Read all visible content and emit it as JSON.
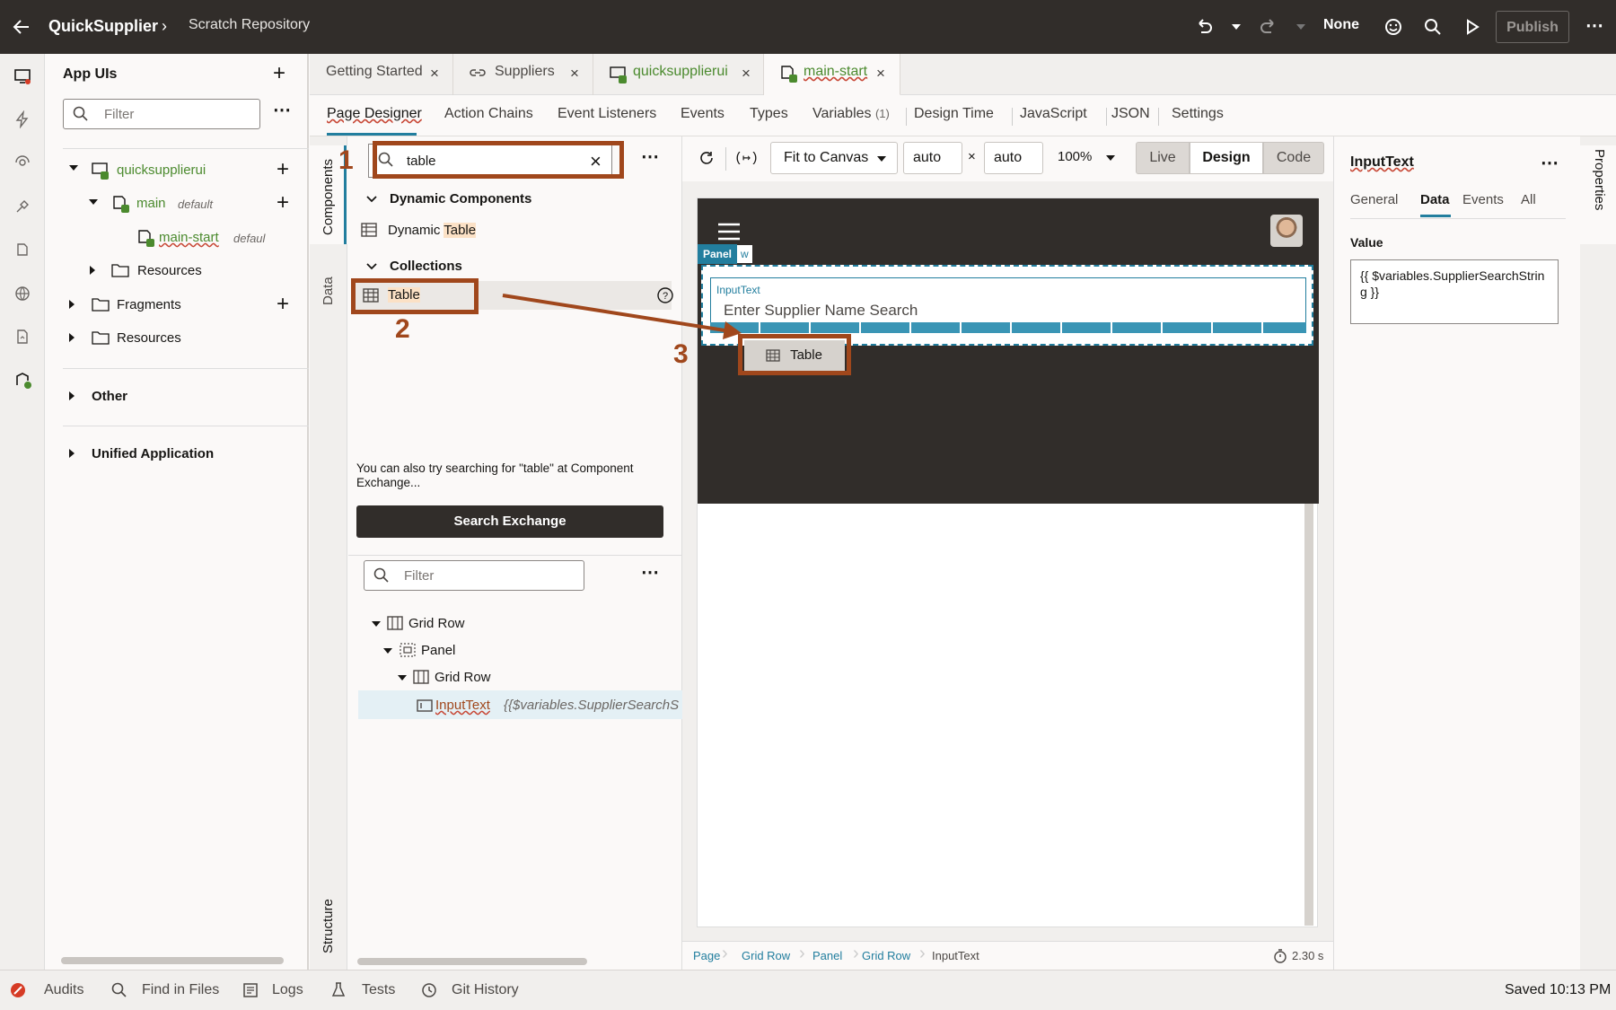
{
  "header": {
    "app_name": "QuickSupplier",
    "breadcrumb": "Scratch Repository",
    "profile": "None",
    "publish_label": "Publish"
  },
  "nav": {
    "title": "App UIs",
    "filter_placeholder": "Filter",
    "tree": {
      "app": "quicksupplierui",
      "main": "main",
      "main_meta": "default",
      "main_start": "main-start",
      "main_start_meta": "defaul",
      "resources_inner": "Resources",
      "fragments": "Fragments",
      "resources": "Resources"
    },
    "other": "Other",
    "unified": "Unified Application"
  },
  "tabs": [
    {
      "label": "Getting Started"
    },
    {
      "label": "Suppliers"
    },
    {
      "label": "quicksupplierui"
    },
    {
      "label": "main-start"
    }
  ],
  "subtabs": {
    "page_designer": "Page Designer",
    "action_chains": "Action Chains",
    "event_listeners": "Event Listeners",
    "events": "Events",
    "types": "Types",
    "variables": "Variables",
    "variables_count": "(1)",
    "design_time": "Design Time",
    "javascript": "JavaScript",
    "json": "JSON",
    "settings": "Settings"
  },
  "vertical_tabs": {
    "components": "Components",
    "data": "Data",
    "structure": "Structure",
    "properties": "Properties"
  },
  "components": {
    "search_value": "table",
    "group_dynamic": "Dynamic Components",
    "dynamic_table_prefix": "Dynamic ",
    "dynamic_table_match": "Table",
    "group_collections": "Collections",
    "table_item": "Table",
    "exchange_hint": "You can also try searching for \"table\" at Component Exchange...",
    "search_exchange": "Search Exchange"
  },
  "structure": {
    "filter_placeholder": "Filter",
    "nodes": {
      "grid_row_1": "Grid Row",
      "panel": "Panel",
      "grid_row_2": "Grid Row",
      "input_text": "InputText",
      "input_text_value": "{{$variables.SupplierSearchS"
    }
  },
  "canvas_toolbar": {
    "fit": "Fit to Canvas",
    "width": "auto",
    "times": "×",
    "height": "auto",
    "zoom": "100%",
    "live": "Live",
    "design": "Design",
    "code": "Code"
  },
  "canvas": {
    "panel_badge": "Panel",
    "panel_badge_tail": "w",
    "input_label": "InputText",
    "input_placeholder": "Enter Supplier Name Search",
    "drag_label": "Table"
  },
  "annotations": {
    "one": "1",
    "two": "2",
    "three": "3"
  },
  "breadcrumb_bar": {
    "items": [
      "Page",
      "Grid Row",
      "Panel",
      "Grid Row",
      "InputText"
    ],
    "timing": "2.30 s"
  },
  "properties": {
    "title": "InputText",
    "tabs": [
      "General",
      "Data",
      "Events",
      "All"
    ],
    "value_label": "Value",
    "value_text": "{{ $variables.SupplierSearchString }}"
  },
  "bottom": {
    "audits": "Audits",
    "find": "Find in Files",
    "logs": "Logs",
    "tests": "Tests",
    "git": "Git History",
    "saved": "Saved 10:13 PM"
  },
  "colors": {
    "header_bg": "#312d2a",
    "accent_green": "#4b8a2e",
    "accent_blue": "#227e9e",
    "annotation_orange": "#a0471c",
    "canvas_dark": "#312d2a"
  }
}
